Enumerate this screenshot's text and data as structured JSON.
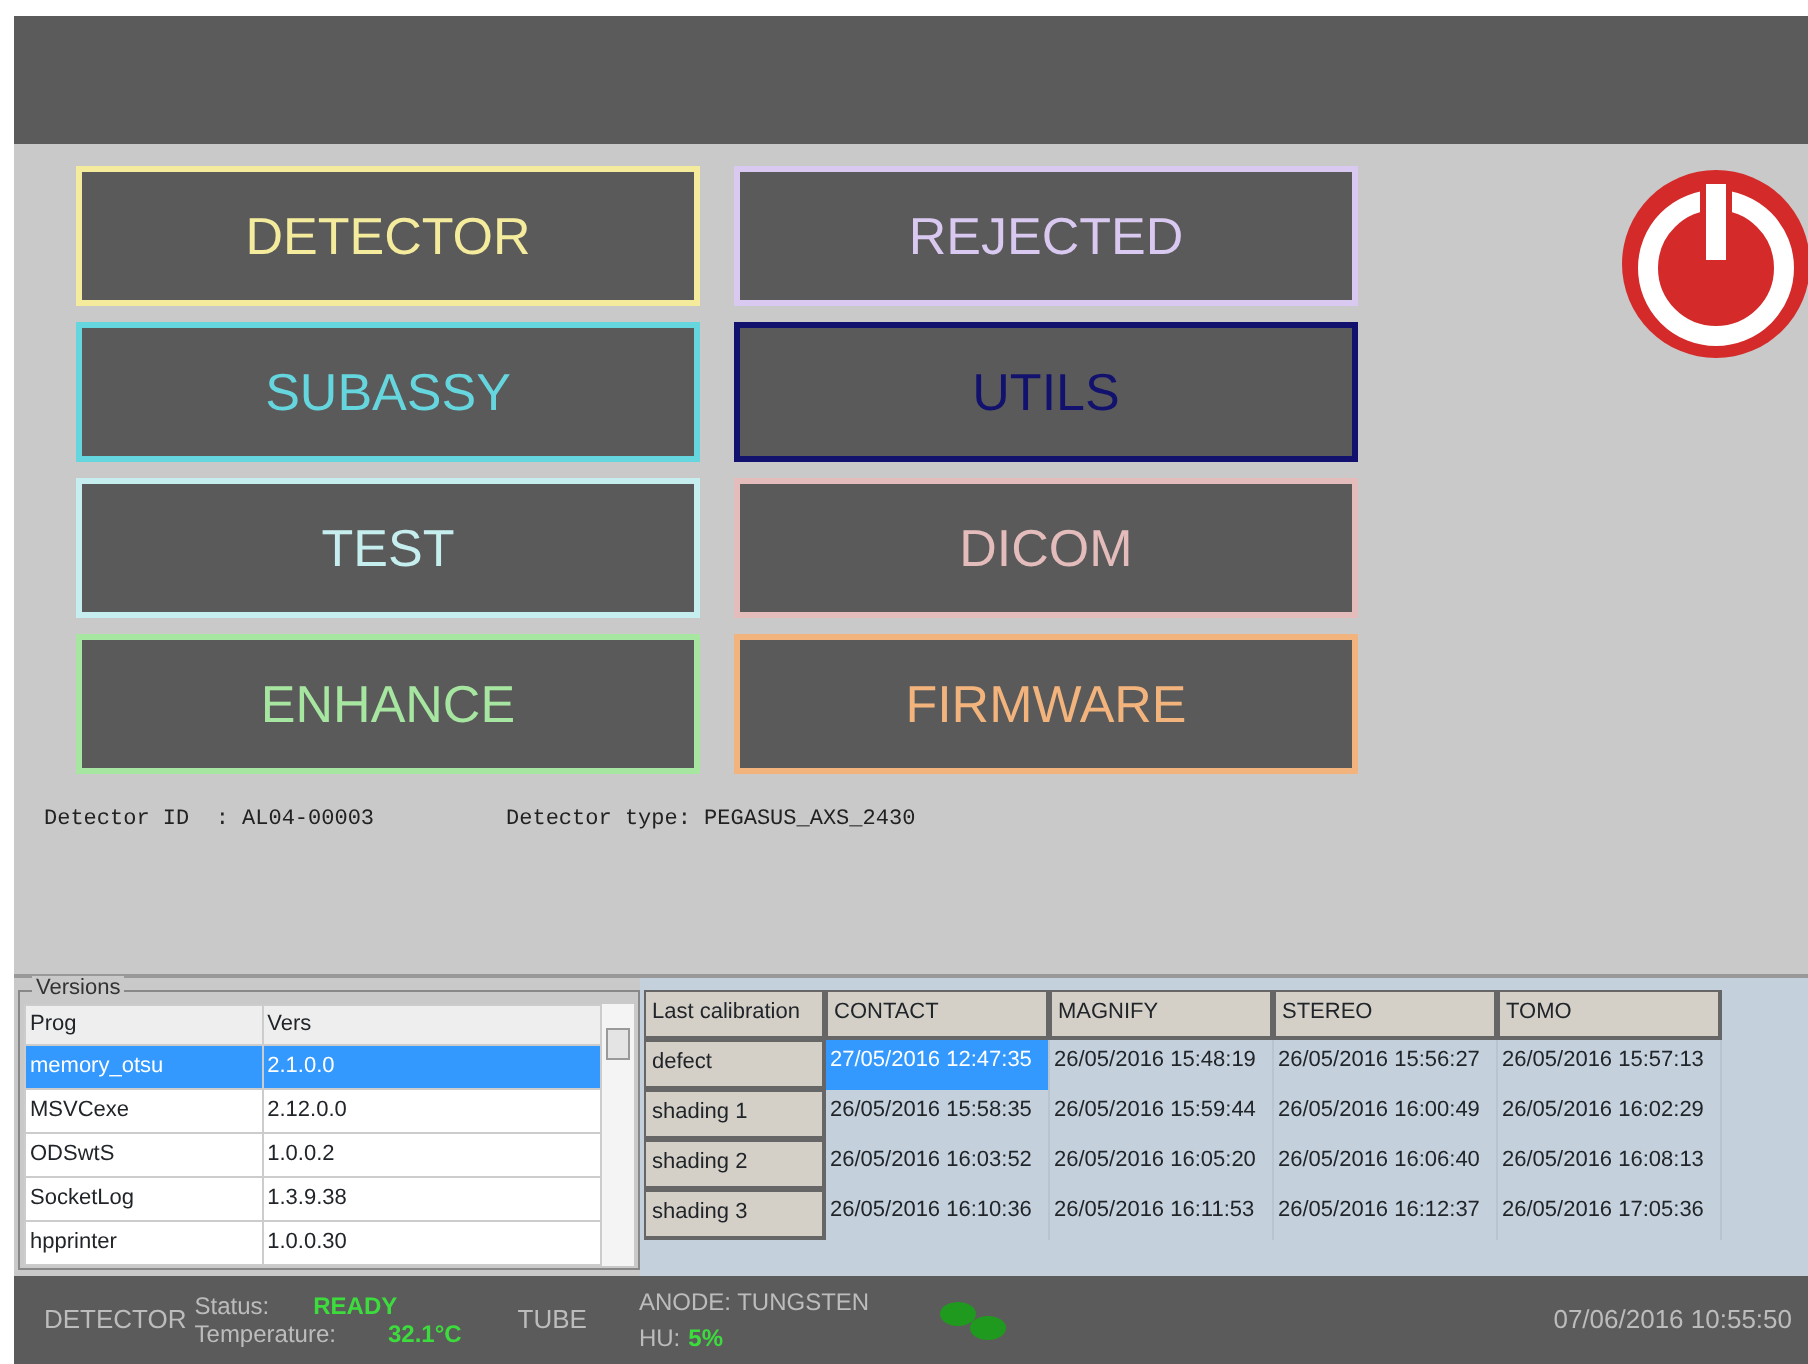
{
  "menu_buttons": [
    {
      "label": "DETECTOR",
      "color": "#f4ec9c"
    },
    {
      "label": "REJECTED",
      "color": "#d9c8f0"
    },
    {
      "label": "SUBASSY",
      "color": "#66d6de"
    },
    {
      "label": "UTILS",
      "color": "#12126e"
    },
    {
      "label": "TEST",
      "color": "#c6eeee"
    },
    {
      "label": "DICOM",
      "color": "#e4bcbc"
    },
    {
      "label": "ENHANCE",
      "color": "#a6e6a0"
    },
    {
      "label": "FIRMWARE",
      "color": "#f2b47c"
    }
  ],
  "detector_info": {
    "id": "Detector ID  : AL04-00003",
    "type": "Detector type: PEGASUS_AXS_2430"
  },
  "versions": {
    "title": "Versions",
    "columns": [
      "Prog",
      "Vers"
    ],
    "rows": [
      {
        "cells": [
          "memory_otsu",
          "2.1.0.0"
        ],
        "selected": true
      },
      {
        "cells": [
          "MSVCexe",
          "2.12.0.0"
        ],
        "selected": false
      },
      {
        "cells": [
          "ODSwtS",
          "1.0.0.2"
        ],
        "selected": false
      },
      {
        "cells": [
          "SocketLog",
          "1.3.9.38"
        ],
        "selected": false
      },
      {
        "cells": [
          "hpprinter",
          "1.0.0.30"
        ],
        "selected": false
      }
    ]
  },
  "calibration": {
    "corner": "Last calibration",
    "columns": [
      "CONTACT",
      "MAGNIFY",
      "STEREO",
      "TOMO"
    ],
    "rows": [
      {
        "label": "defect",
        "cells": [
          {
            "text": "27/05/2016 12:47:35",
            "selected": true
          },
          {
            "text": "26/05/2016 15:48:19",
            "selected": false
          },
          {
            "text": "26/05/2016 15:56:27",
            "selected": false
          },
          {
            "text": "26/05/2016 15:57:13",
            "selected": false
          }
        ]
      },
      {
        "label": "shading 1",
        "cells": [
          {
            "text": "26/05/2016 15:58:35",
            "selected": false
          },
          {
            "text": "26/05/2016 15:59:44",
            "selected": false
          },
          {
            "text": "26/05/2016 16:00:49",
            "selected": false
          },
          {
            "text": "26/05/2016 16:02:29",
            "selected": false
          }
        ]
      },
      {
        "label": "shading 2",
        "cells": [
          {
            "text": "26/05/2016 16:03:52",
            "selected": false
          },
          {
            "text": "26/05/2016 16:05:20",
            "selected": false
          },
          {
            "text": "26/05/2016 16:06:40",
            "selected": false
          },
          {
            "text": "26/05/2016 16:08:13",
            "selected": false
          }
        ]
      },
      {
        "label": "shading 3",
        "cells": [
          {
            "text": "26/05/2016 16:10:36",
            "selected": false
          },
          {
            "text": "26/05/2016 16:11:53",
            "selected": false
          },
          {
            "text": "26/05/2016 16:12:37",
            "selected": false
          },
          {
            "text": "26/05/2016 17:05:36",
            "selected": false
          }
        ]
      }
    ]
  },
  "status_bar": {
    "detector": "DETECTOR",
    "status_label": "Status:",
    "status_value": "READY",
    "temperature_label": "Temperature:",
    "temperature_value": "32.1°C",
    "tube": "TUBE",
    "anode": "ANODE: TUNGSTEN",
    "hu_label": "HU:",
    "hu_value": "5%",
    "datetime": "07/06/2016 10:55:50"
  }
}
